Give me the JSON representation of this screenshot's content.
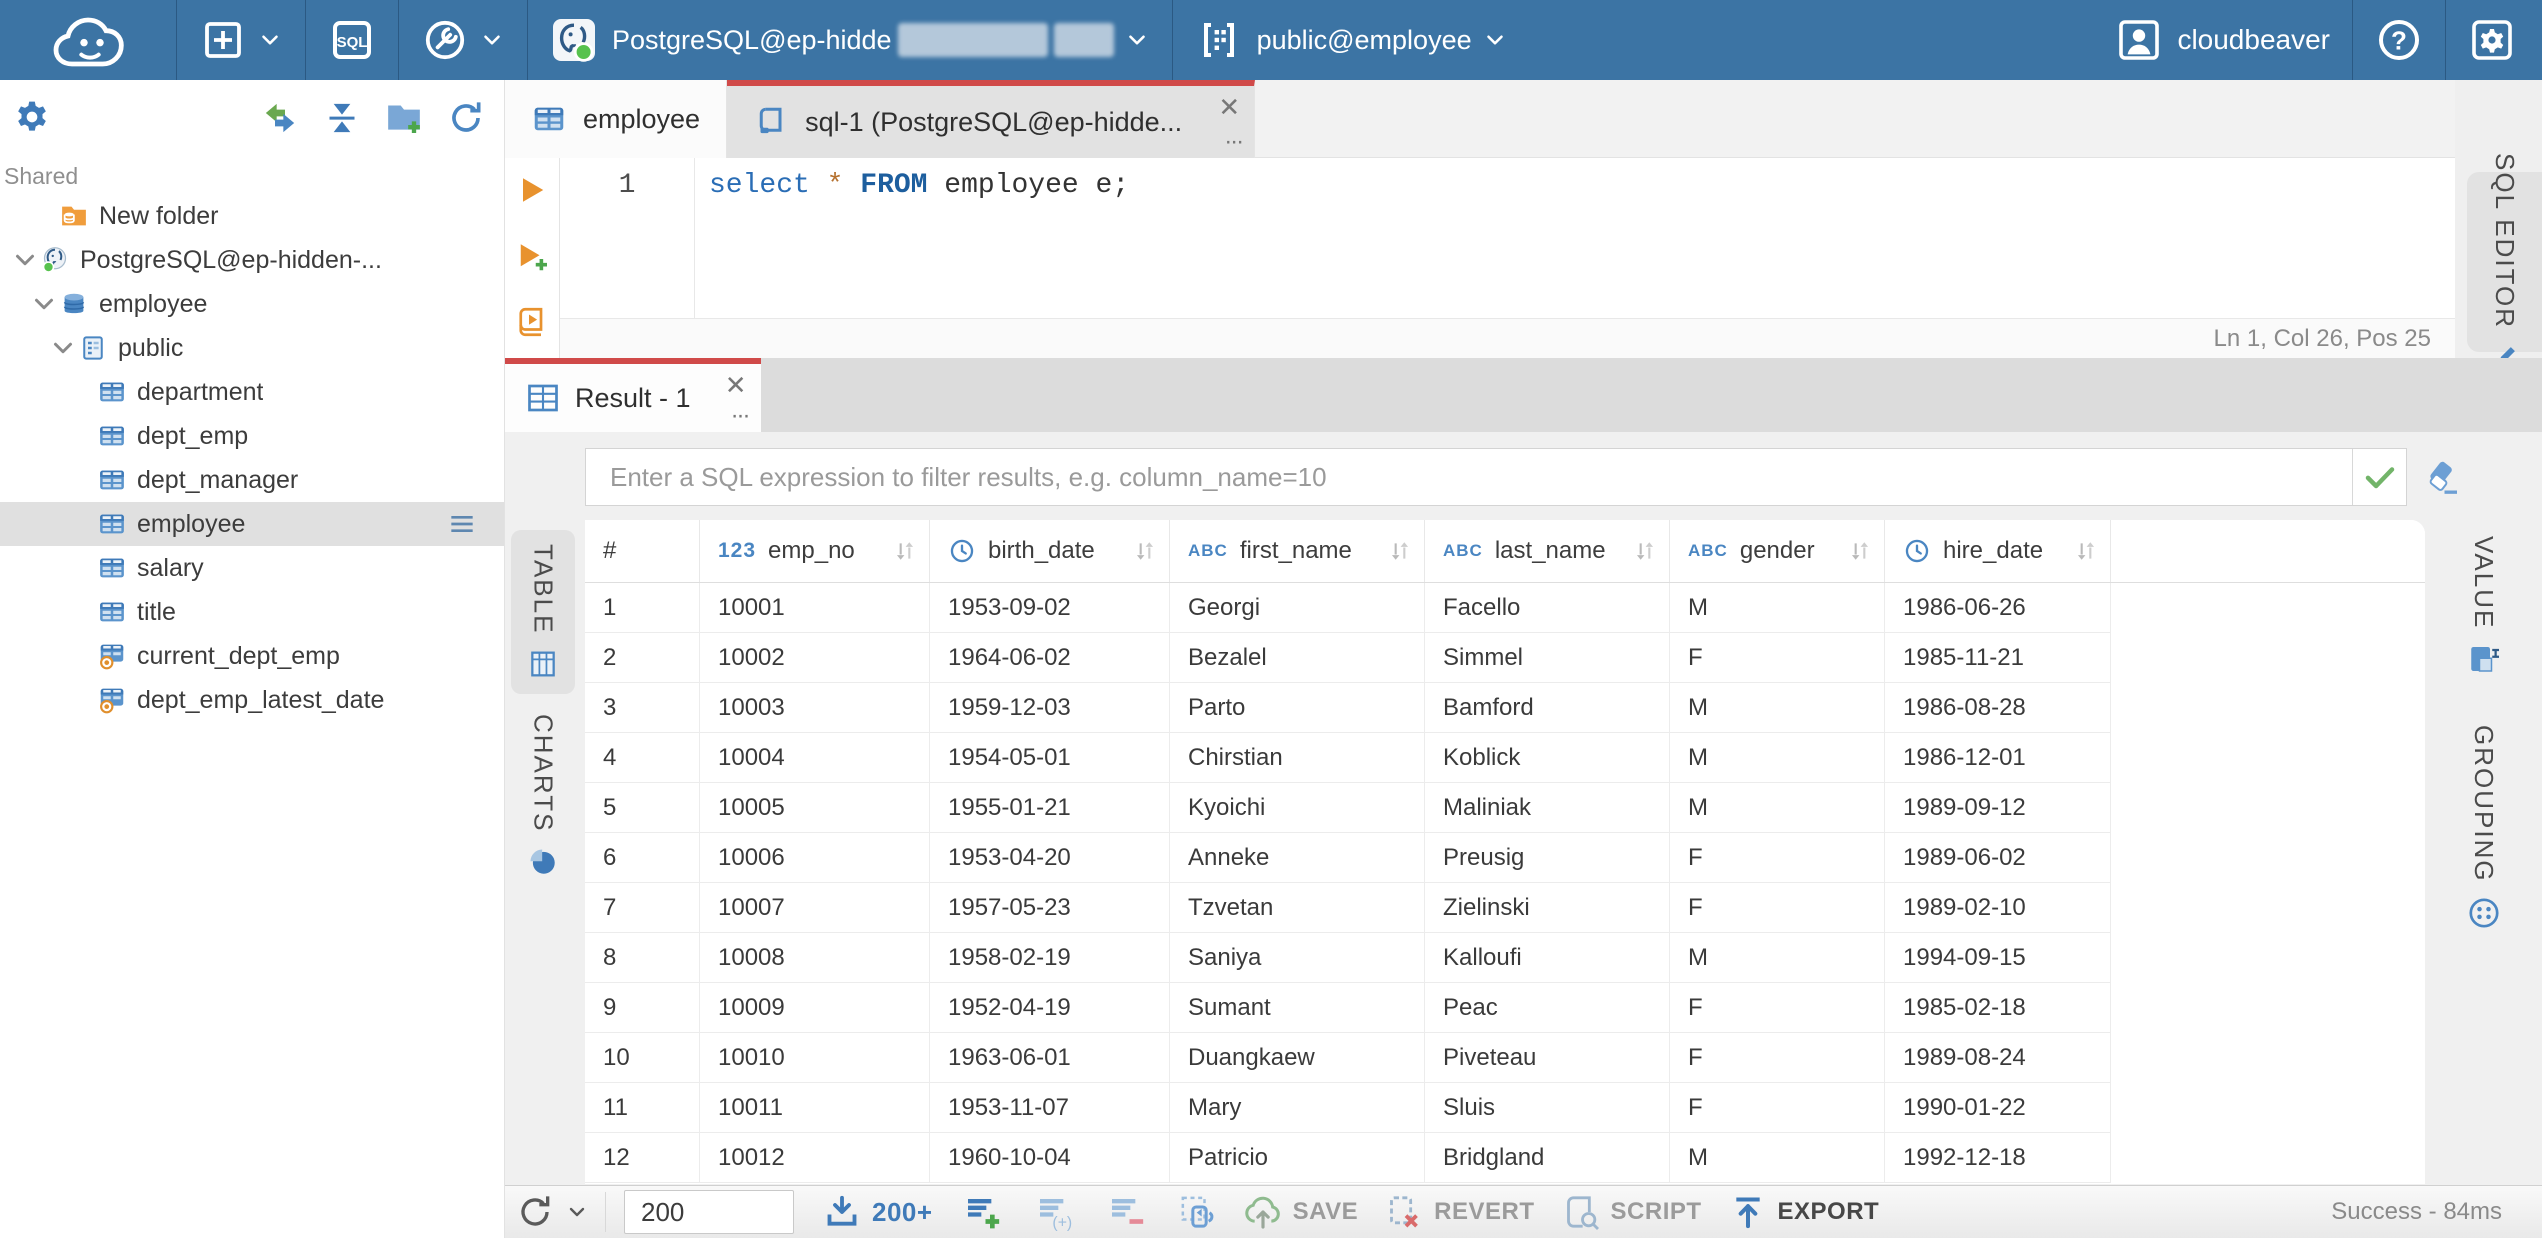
{
  "ui": {
    "close": "✕",
    "more": "···"
  },
  "topbar": {
    "app_name": "cloudbeaver",
    "connection_label": "PostgreSQL@ep-hidde",
    "schema_label": "public@employee"
  },
  "sidebar": {
    "section_label": "Shared",
    "tree": [
      {
        "label": "New folder",
        "icon": "folderdb",
        "level": 1
      },
      {
        "label": "PostgreSQL@ep-hidden-...",
        "icon": "pg",
        "level": 0,
        "expanded": true
      },
      {
        "label": "employee",
        "icon": "db",
        "level": 1,
        "expanded": true
      },
      {
        "label": "public",
        "icon": "schema",
        "level": 2,
        "expanded": true
      },
      {
        "label": "department",
        "icon": "table",
        "level": 3
      },
      {
        "label": "dept_emp",
        "icon": "table",
        "level": 3
      },
      {
        "label": "dept_manager",
        "icon": "table",
        "level": 3
      },
      {
        "label": "employee",
        "icon": "table",
        "level": 3,
        "selected": true
      },
      {
        "label": "salary",
        "icon": "table",
        "level": 3
      },
      {
        "label": "title",
        "icon": "table",
        "level": 3
      },
      {
        "label": "current_dept_emp",
        "icon": "view",
        "level": 3
      },
      {
        "label": "dept_emp_latest_date",
        "icon": "view",
        "level": 3
      }
    ]
  },
  "editor_tabs": {
    "tab1": "employee",
    "tab2": "sql-1 (PostgreSQL@ep-hidde..."
  },
  "editor": {
    "line_number": "1",
    "code": {
      "kw1": "select",
      "star": "*",
      "kw2": "FROM",
      "rest": " employee e;"
    },
    "status": "Ln 1, Col 26, Pos 25",
    "side_tab": "SQL EDITOR"
  },
  "result": {
    "tab_label": "Result - 1",
    "filter_placeholder": "Enter a SQL expression to filter results, e.g. column_name=10",
    "left_tabs": {
      "table": "TABLE",
      "charts": "CHARTS"
    },
    "right_tabs": {
      "value": "VALUE",
      "grouping": "GROUPING"
    },
    "grid": {
      "index_header": "#",
      "type_badges": {
        "numeric": "123",
        "text": "ABC"
      },
      "columns": [
        {
          "label": "emp_no",
          "type": "numeric"
        },
        {
          "label": "birth_date",
          "type": "date"
        },
        {
          "label": "first_name",
          "type": "text"
        },
        {
          "label": "last_name",
          "type": "text"
        },
        {
          "label": "gender",
          "type": "text"
        },
        {
          "label": "hire_date",
          "type": "date"
        }
      ],
      "rows": [
        [
          "1",
          "10001",
          "1953-09-02",
          "Georgi",
          "Facello",
          "M",
          "1986-06-26"
        ],
        [
          "2",
          "10002",
          "1964-06-02",
          "Bezalel",
          "Simmel",
          "F",
          "1985-11-21"
        ],
        [
          "3",
          "10003",
          "1959-12-03",
          "Parto",
          "Bamford",
          "M",
          "1986-08-28"
        ],
        [
          "4",
          "10004",
          "1954-05-01",
          "Chirstian",
          "Koblick",
          "M",
          "1986-12-01"
        ],
        [
          "5",
          "10005",
          "1955-01-21",
          "Kyoichi",
          "Maliniak",
          "M",
          "1989-09-12"
        ],
        [
          "6",
          "10006",
          "1953-04-20",
          "Anneke",
          "Preusig",
          "F",
          "1989-06-02"
        ],
        [
          "7",
          "10007",
          "1957-05-23",
          "Tzvetan",
          "Zielinski",
          "F",
          "1989-02-10"
        ],
        [
          "8",
          "10008",
          "1958-02-19",
          "Saniya",
          "Kalloufi",
          "M",
          "1994-09-15"
        ],
        [
          "9",
          "10009",
          "1952-04-19",
          "Sumant",
          "Peac",
          "F",
          "1985-02-18"
        ],
        [
          "10",
          "10010",
          "1963-06-01",
          "Duangkaew",
          "Piveteau",
          "F",
          "1989-08-24"
        ],
        [
          "11",
          "10011",
          "1953-11-07",
          "Mary",
          "Sluis",
          "F",
          "1990-01-22"
        ],
        [
          "12",
          "10012",
          "1960-10-04",
          "Patricio",
          "Bridgland",
          "M",
          "1992-12-18"
        ]
      ]
    }
  },
  "bottom_toolbar": {
    "limit_value": "200",
    "fetch_more": "200+",
    "save": "SAVE",
    "revert": "REVERT",
    "script": "SCRIPT",
    "export": "EXPORT",
    "status": "Success - 84ms"
  }
}
